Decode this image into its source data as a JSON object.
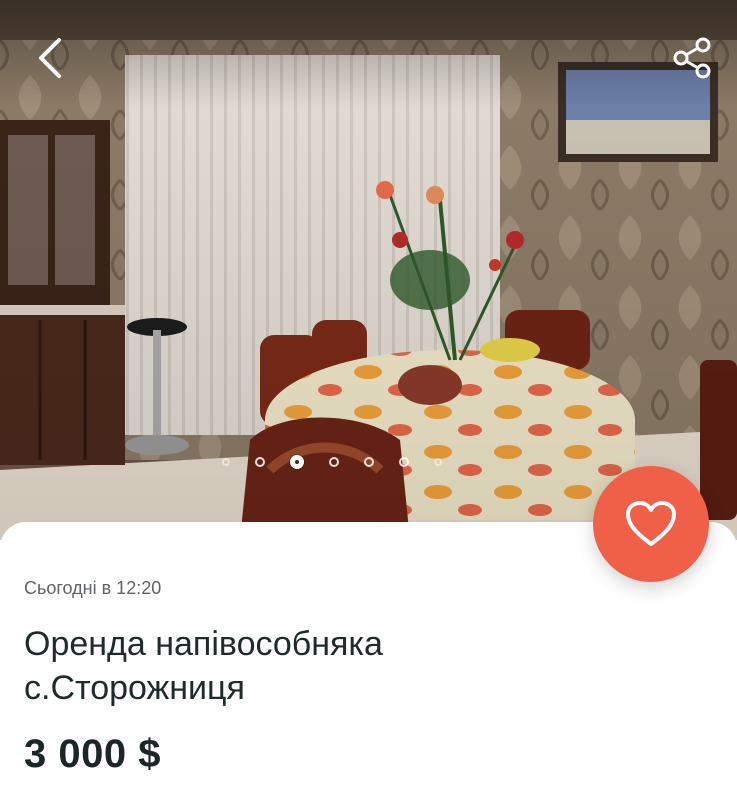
{
  "listing": {
    "posted": "Сьогодні в 12:20",
    "title": "Оренда напівособняка с.Сторожниця",
    "price": "3 000 $"
  },
  "gallery": {
    "dot_count": 7,
    "active_index": 2
  },
  "icons": {
    "back": "chevron-left-icon",
    "share": "share-icon",
    "favorite": "heart-outline-icon"
  },
  "colors": {
    "favorite_button": "#f06048",
    "text_primary": "#1f2a2a",
    "text_secondary": "#5f6366"
  }
}
